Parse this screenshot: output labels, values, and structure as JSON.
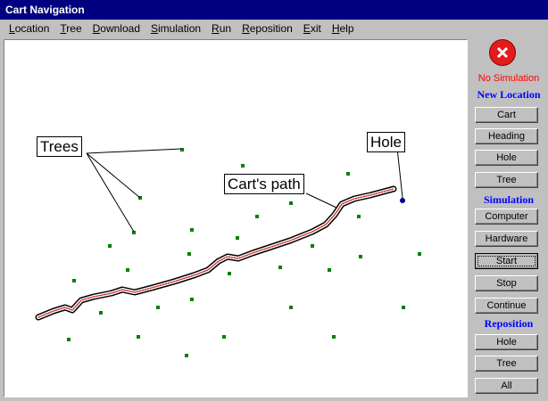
{
  "window": {
    "title": "Cart Navigation"
  },
  "menu": [
    "Location",
    "Tree",
    "Download",
    "Simulation",
    "Run",
    "Reposition",
    "Exit",
    "Help"
  ],
  "canvas": {
    "labels": {
      "trees": "Trees",
      "path": "Cart's path",
      "hole": "Hole"
    },
    "colors": {
      "tree": "#008000",
      "path_outer": "#000000",
      "path_inner": "#cc0000",
      "hole": "#000080"
    }
  },
  "panel": {
    "status": "No Simulation",
    "status_icon": "stop-icon",
    "sections": {
      "new_location": "New Location",
      "simulation": "Simulation",
      "reposition": "Reposition"
    },
    "new_location_buttons": [
      "Cart",
      "Heading",
      "Hole",
      "Tree"
    ],
    "simulation_buttons": [
      "Computer",
      "Hardware",
      "Start",
      "Stop",
      "Continue"
    ],
    "reposition_buttons": [
      "Hole",
      "Tree",
      "All"
    ]
  }
}
